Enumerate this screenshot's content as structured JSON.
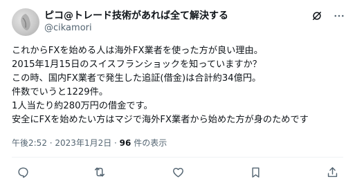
{
  "tweet": {
    "display_name": "ピコ@トレード技術があれば全て解決する",
    "handle": "@cikamori",
    "lines": [
      "これからFXを始める人は海外FX業者を使った方が良い理由。",
      "2015年1月15日のスイスフランショックを知っていますか？",
      "この時、国内FX業者で発生した追証(借金)は合計約34億円。",
      "件数でいうと1229件。",
      "1人当たり約280万円の借金です。",
      "安全にFXを始めたい方はマジで海外FX業者から始めた方が身のためです"
    ],
    "time": "午後2:52",
    "date": "2023年1月2日",
    "separator": " · ",
    "views_count": "96",
    "views_label": " 件の表示"
  },
  "icons": {
    "header": [
      "grok-icon",
      "more-icon"
    ],
    "actions": [
      "reply-icon",
      "retweet-icon",
      "like-icon",
      "bookmark-icon",
      "share-icon"
    ]
  },
  "colors": {
    "text": "#0f1419",
    "secondary": "#536471",
    "divider": "#eff3f4"
  }
}
